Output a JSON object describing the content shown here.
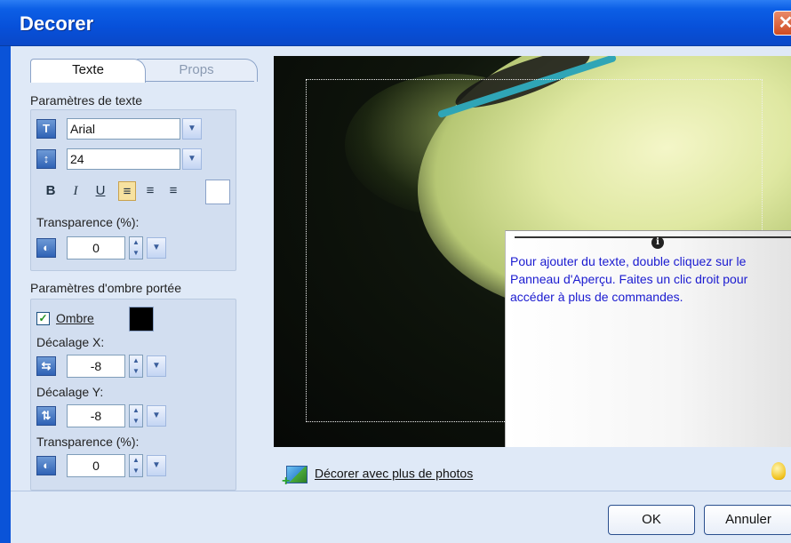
{
  "window": {
    "title": "Decorer",
    "close_glyph": "✕"
  },
  "tabs": [
    {
      "label": "Texte"
    },
    {
      "label": "Props"
    }
  ],
  "text_params": {
    "section_title": "Paramètres de texte",
    "font_value": "Arial",
    "size_value": "24",
    "format_buttons": {
      "bold": "B",
      "italic": "I",
      "underline": "U"
    },
    "align_icons": [
      "align-left-icon",
      "align-center-icon",
      "align-right-icon"
    ],
    "text_color": "#ffffff",
    "transparency_label": "Transparence (%):",
    "transparency_value": "0"
  },
  "shadow_params": {
    "section_title": "Paramètres d'ombre portée",
    "shadow_label": "Ombre",
    "shadow_checked": true,
    "shadow_color": "#000000",
    "offset_x_label": "Décalage X:",
    "offset_x_value": "-8",
    "offset_y_label": "Décalage Y:",
    "offset_y_value": "-8",
    "transparency_label": "Transparence (%):",
    "transparency_value": "0"
  },
  "preview": {
    "tip_text": "Pour ajouter du texte, double cliquez sur le Panneau d'Aperçu. Faites un clic droit pour accéder à plus de commandes."
  },
  "more_photos_label": "Décorer avec plus de photos",
  "buttons": {
    "ok": "OK",
    "cancel": "Annuler"
  }
}
